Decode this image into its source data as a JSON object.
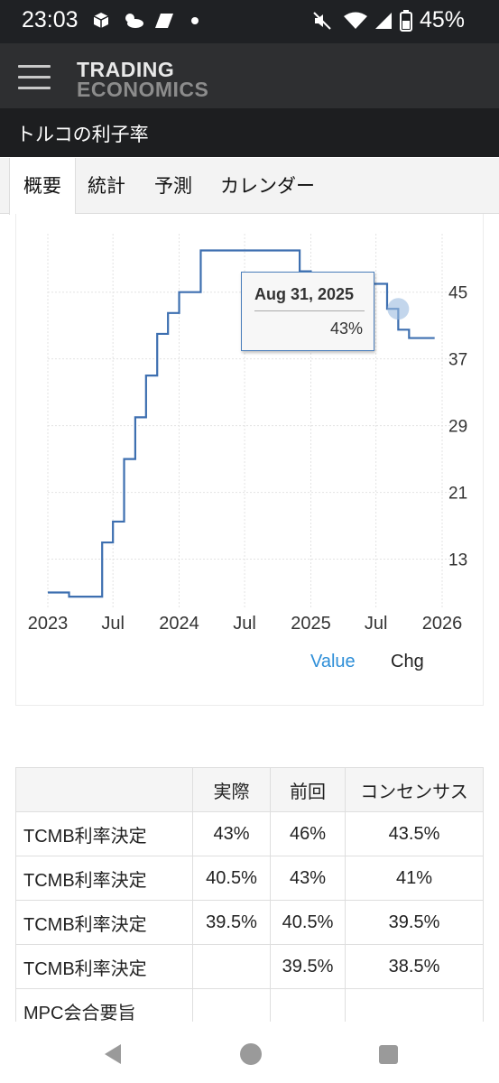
{
  "status_bar": {
    "time": "23:03",
    "battery": "45%",
    "icons": [
      "box-icon",
      "weather-icon",
      "slash-app-icon",
      "dot-icon",
      "mute-icon",
      "wifi-icon",
      "signal-icon",
      "battery-icon"
    ]
  },
  "header": {
    "logo_line1": "TRADING",
    "logo_line2": "ECONOMICS",
    "page_title": "トルコの利子率"
  },
  "tabs": [
    {
      "label": "概要",
      "active": true
    },
    {
      "label": "統計",
      "active": false
    },
    {
      "label": "予測",
      "active": false
    },
    {
      "label": "カレンダー",
      "active": false
    }
  ],
  "chart_data": {
    "type": "line",
    "step": true,
    "x_ticks": [
      "2023",
      "Jul",
      "2024",
      "Jul",
      "2025",
      "Jul",
      "2026"
    ],
    "y_ticks": [
      13,
      21,
      29,
      37,
      45
    ],
    "ylim": [
      7,
      52
    ],
    "xlim": [
      "2023-01-01",
      "2026-01-01"
    ],
    "grid": true,
    "y_axis_side": "right",
    "series": [
      {
        "points": [
          [
            "2023-01-01",
            9
          ],
          [
            "2023-03-01",
            8.5
          ],
          [
            "2023-06-01",
            15
          ],
          [
            "2023-07-01",
            17.5
          ],
          [
            "2023-08-01",
            25
          ],
          [
            "2023-09-01",
            30
          ],
          [
            "2023-10-01",
            35
          ],
          [
            "2023-11-01",
            40
          ],
          [
            "2023-12-01",
            42.5
          ],
          [
            "2024-01-01",
            45
          ],
          [
            "2024-03-01",
            50
          ],
          [
            "2024-12-01",
            47.5
          ],
          [
            "2025-01-01",
            45
          ],
          [
            "2025-03-01",
            46
          ],
          [
            "2025-08-01",
            43
          ],
          [
            "2025-09-01",
            40.5
          ],
          [
            "2025-10-01",
            39.5
          ],
          [
            "2025-11-01",
            39.5
          ]
        ]
      }
    ],
    "tooltip": {
      "date": "Aug 31, 2025",
      "value": "43%"
    },
    "legend": {
      "value": "Value",
      "chg": "Chg"
    }
  },
  "calendar_table": {
    "headers": [
      "",
      "実際",
      "前回",
      "コンセンサス"
    ],
    "rows": [
      {
        "name": "TCMB利率決定",
        "actual": "43%",
        "previous": "46%",
        "consensus": "43.5%"
      },
      {
        "name": "TCMB利率決定",
        "actual": "40.5%",
        "previous": "43%",
        "consensus": "41%"
      },
      {
        "name": "TCMB利率決定",
        "actual": "39.5%",
        "previous": "40.5%",
        "consensus": "39.5%"
      },
      {
        "name": "TCMB利率決定",
        "actual": "",
        "previous": "39.5%",
        "consensus": "38.5%"
      },
      {
        "name": "MPC会合要旨",
        "actual": "",
        "previous": "",
        "consensus": ""
      }
    ]
  },
  "nav_bar": {
    "icons": [
      "back-icon",
      "home-icon",
      "recents-icon"
    ]
  }
}
